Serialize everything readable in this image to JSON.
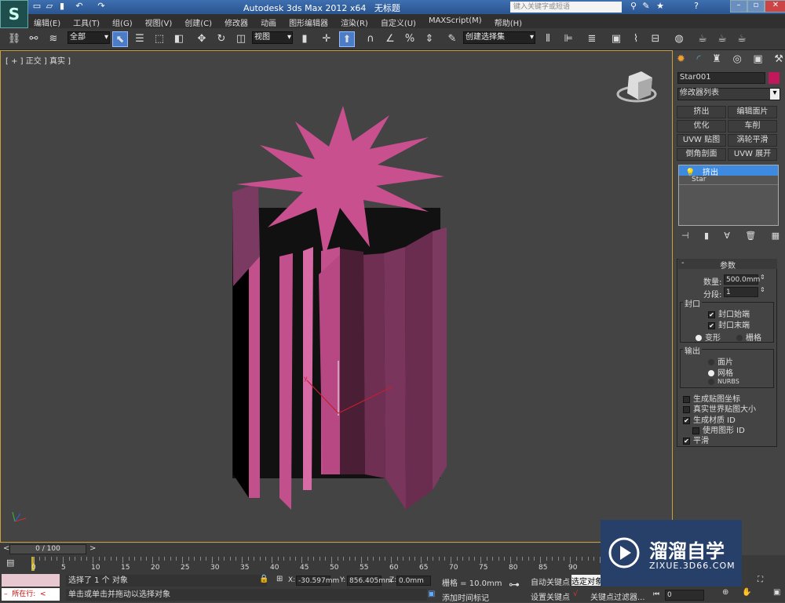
{
  "title": {
    "app": "Autodesk 3ds Max  2012 x64",
    "doc": "无标题",
    "search_placeholder": "键入关键字或短语"
  },
  "menu": [
    "编辑(E)",
    "工具(T)",
    "组(G)",
    "视图(V)",
    "创建(C)",
    "修改器",
    "动画",
    "图形编辑器",
    "渲染(R)",
    "自定义(U)",
    "MAXScript(M)",
    "帮助(H)"
  ],
  "toolbar": {
    "filter": "全部",
    "refcoord": "视图",
    "selection_set": "创建选择集"
  },
  "viewport": {
    "label": "[ + ] 正交 ] 真实 ]",
    "axis_labels": {
      "x": "x",
      "y": "y",
      "z": "z"
    }
  },
  "panel": {
    "object_name": "Star001",
    "object_color": "#c0185a",
    "modifier_list": "修改器列表",
    "modifier_buttons": [
      "挤出",
      "编辑面片",
      "优化",
      "车削",
      "UVW 贴图",
      "涡轮平滑",
      "倒角剖面",
      "UVW 展开"
    ],
    "stack": [
      {
        "label": "挤出",
        "selected": true
      },
      {
        "label": "Star",
        "selected": false
      }
    ],
    "rollout_title": "参数",
    "amount_label": "数量:",
    "amount_value": "500.0mm",
    "segments_label": "分段:",
    "segments_value": "1",
    "capping": {
      "title": "封口",
      "cap_start": "封口始端",
      "cap_end": "封口末端",
      "morph": "变形",
      "grid": "栅格"
    },
    "output": {
      "title": "输出",
      "patch": "面片",
      "mesh": "网格",
      "nurbs": "NURBS"
    },
    "gen_mapping": "生成贴图坐标",
    "real_world": "真实世界贴图大小",
    "gen_matid": "生成材质 ID",
    "use_shape_id": "使用图形 ID",
    "smooth": "平滑"
  },
  "timeline": {
    "frame": "0 / 100",
    "ticks": [
      "0",
      "5",
      "10",
      "15",
      "20",
      "25",
      "30",
      "35",
      "40",
      "45",
      "50",
      "55",
      "60",
      "65",
      "70",
      "75",
      "80",
      "85",
      "90"
    ]
  },
  "status": {
    "script_label": "所在行:",
    "selected": "选择了 1 个 对象",
    "prompt": "单击或单击并拖动以选择对象",
    "x_label": "X:",
    "x": "-30.597mm",
    "y_label": "Y:",
    "y": "856.405mm",
    "z_label": "Z:",
    "z": "0.0mm",
    "grid": "栅格 = 10.0mm",
    "add_time_tag": "添加时间标记",
    "auto_key": "自动关键点",
    "set_key": "设置关键点",
    "selected_obj": "选定对象",
    "key_filters": "关键点过滤器...",
    "frame_value": "0"
  },
  "watermark": {
    "name": "溜溜自学",
    "url": "ZIXUE.3D66.COM"
  },
  "colors": {
    "object": "#c9508e",
    "viewport_border": "#c8a040"
  }
}
